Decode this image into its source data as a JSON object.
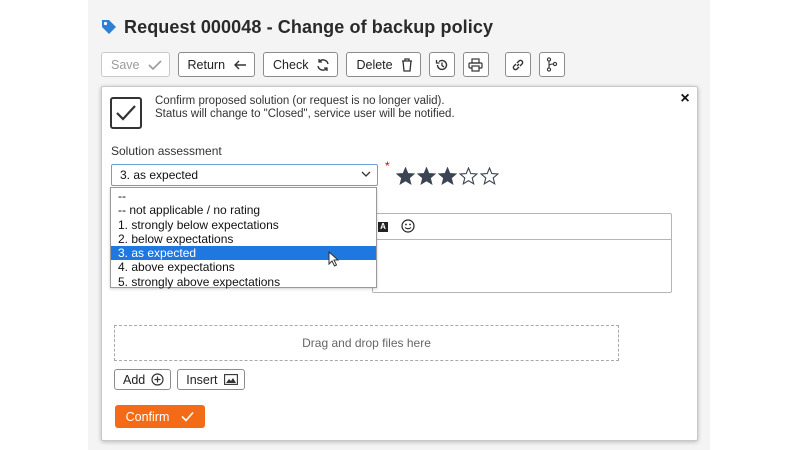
{
  "header": {
    "title": "Request 000048 - Change of backup policy",
    "tag_icon": "tag-icon",
    "tag_color": "#2f7fd3"
  },
  "toolbar": {
    "save_label": "Save",
    "return_label": "Return",
    "check_label": "Check",
    "delete_label": "Delete",
    "icons": [
      "checkmark-icon",
      "arrow-left-icon",
      "refresh-icon",
      "trash-icon",
      "history-icon",
      "print-icon",
      "link-icon",
      "branch-icon"
    ]
  },
  "dialog": {
    "close_label": "×",
    "info_line1": "Confirm proposed solution (or request is no longer valid).",
    "info_line2": "Status will change to \"Closed\", service user will be notified.",
    "assessment_label": "Solution assessment",
    "selected_value": "3. as expected",
    "required_mark": "*",
    "rating_filled": 3,
    "rating_max": 5,
    "options": [
      "--",
      "-- not applicable / no rating",
      "1. strongly below expectations",
      "2. below expectations",
      "3. as expected",
      "4. above expectations",
      "5. strongly above expectations"
    ],
    "highlighted_option": 4,
    "editor_icons": [
      "text-color-icon",
      "smiley-icon"
    ],
    "dropzone_text": "Drag and drop files here",
    "add_label": "Add",
    "insert_label": "Insert",
    "confirm_label": "Confirm"
  },
  "colors": {
    "accent": "#f36b16",
    "selection": "#1e78e0",
    "required": "#d40000",
    "star": "#3a4452"
  }
}
